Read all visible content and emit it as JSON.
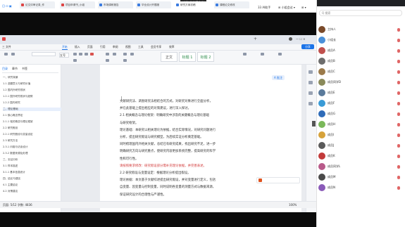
{
  "meeting_bar": {
    "title": "小Y...的快速会议",
    "left_text": "日 ⊡ ▣",
    "right_items": [
      "33 AI助手",
      "⊞ 小组会议 ▾",
      "⊞ ▾"
    ]
  },
  "browser_tabs": [
    {
      "label": "论文评审记录_作",
      "color": "#d44"
    },
    {
      "label": "项目申请书_小组",
      "color": "#d44"
    },
    {
      "label": "市场调研报告",
      "color": "#3a7be0"
    },
    {
      "label": "毕业设计开题报",
      "color": "#3a7be0"
    },
    {
      "label": "研究方案初稿",
      "color": "#3a7be0"
    },
    {
      "label": "课程论文修改",
      "color": "#3a7be0"
    }
  ],
  "menu": {
    "items": [
      "三 文件",
      "开始",
      "插入",
      "页面",
      "引用",
      "审阅",
      "视图",
      "工具",
      "会员专享",
      "效率"
    ],
    "active": "开始",
    "share_label": "分享"
  },
  "ribbon": {
    "styles": [
      "正文",
      "标题 1",
      "标题 2"
    ],
    "font_size": "五号"
  },
  "left_panel": {
    "tabs": [
      "目录",
      "章节",
      "书签"
    ],
    "items": [
      {
        "label": "一、研究背景",
        "sel": false
      },
      {
        "label": "  1.1 选题意义与研究价值",
        "sel": false
      },
      {
        "label": "  1.2 国内外研究现状",
        "sel": false
      },
      {
        "label": "    1.2.1 国外研究现状与趋势",
        "sel": false
      },
      {
        "label": "    1.2.2 国内研究",
        "sel": false
      },
      {
        "label": "二、理论基础",
        "sel": true
      },
      {
        "label": "  2.1 核心概念界定",
        "sel": false
      },
      {
        "label": "    2.1.1 相关概念与理论框架",
        "sel": false
      },
      {
        "label": "  2.2 研究假设",
        "sel": false
      },
      {
        "label": "    2.2.1 研究假设与变量设定",
        "sel": false
      },
      {
        "label": "  2.3 研究方法",
        "sel": false
      },
      {
        "label": "    2.3.1 问卷与访谈设计",
        "sel": false
      },
      {
        "label": "    2.3.2 数据来源及处理",
        "sel": false
      },
      {
        "label": "三、实证分析",
        "sel": false
      },
      {
        "label": "  3.1 样本描述",
        "sel": false
      },
      {
        "label": "    3.1.1 基本信息统计",
        "sel": false
      },
      {
        "label": "四、结论与建议",
        "sel": false
      },
      {
        "label": "  4.1 主要结论",
        "sel": false
      },
      {
        "label": "  4.2 对策建议",
        "sel": false
      }
    ]
  },
  "document": {
    "paragraphs": [
      {
        "text": "文献研究法、调查研究法相结合的方式，对研究对象进行全面分析，",
        "red": false
      },
      {
        "text": "并在此基础上提出相应的对策建议，进行深入探讨。",
        "red": false
      },
      {
        "text": "2.1 相关概念与理论框架：明确研究中涉及的关键概念与理论基础",
        "red": false
      },
      {
        "text": "与研究框架。",
        "red": false
      },
      {
        "text": "理论基础：本研究以相关理论为依据，结合实际情况，对研究问题进行",
        "red": false
      },
      {
        "text": "分析，提出研究假设与研究模型，为后续实证分析奠定基础。",
        "red": false
      },
      {
        "text": "同时梳理国内外相关文献，总结已有研究成果，找出研究不足，进一步",
        "red": false
      },
      {
        "text": "明确研究方向与研究重点，使研究内容更加系统完整，提高研究的科学",
        "red": false
      },
      {
        "text": "性和可行性。",
        "red": false
      },
      {
        "text": "请按照要求修改：研究假设部分需补充理论依据，并完善表述。",
        "red": true
      },
      {
        "text": "2.2 研究假设与变量设定：根据理论分析提出假设。",
        "red": false
      },
      {
        "text": "理论依据：本文基于文献综述提出研究假设，并对变量进行定义，包括",
        "red": false
      },
      {
        "text": "自变量、因变量与控制变量，同时说明各变量的测量方式与数据来源，",
        "red": false
      },
      {
        "text": "保证研究设计的合理性与严谨性。",
        "red": false
      }
    ]
  },
  "comment_badge": "A 批注",
  "status_bar": {
    "left": "页面: 5/12  字数: 4836",
    "zoom": "100%"
  },
  "participants_panel": {
    "header": "Q 搜索",
    "people": [
      {
        "name": "主持人",
        "color": "#7a4a2a",
        "muted": false
      },
      {
        "name": "小组长",
        "color": "#4a90d9",
        "muted": false
      },
      {
        "name": "成员A",
        "color": "#c0504d",
        "muted": false
      },
      {
        "name": "成员B",
        "color": "#6d6d6d",
        "muted": false
      },
      {
        "name": "成员C",
        "color": "#9b7a4a",
        "muted": false
      },
      {
        "name": "成员同学D",
        "color": "#8a8a5a",
        "muted": false
      },
      {
        "name": "成员E",
        "color": "#5a7a9b",
        "muted": false
      },
      {
        "name": "成员F",
        "color": "#3a9bd6",
        "muted": false
      },
      {
        "name": "成员G",
        "color": "#2e6bb8",
        "muted": false
      },
      {
        "name": "成员H",
        "color": "#7ab85a",
        "muted": false
      },
      {
        "name": "成员I",
        "color": "#d6a23a",
        "muted": false
      },
      {
        "name": "成员J",
        "color": "#5a5a5a",
        "muted": false
      },
      {
        "name": "成员K",
        "color": "#c23a3a",
        "muted": false
      },
      {
        "name": "成员同学L",
        "color": "#b85a8a",
        "muted": false
      },
      {
        "name": "成员M",
        "color": "#4a4a4a",
        "muted": false
      },
      {
        "name": "成员N",
        "color": "#8a5ab8",
        "muted": false
      }
    ]
  }
}
